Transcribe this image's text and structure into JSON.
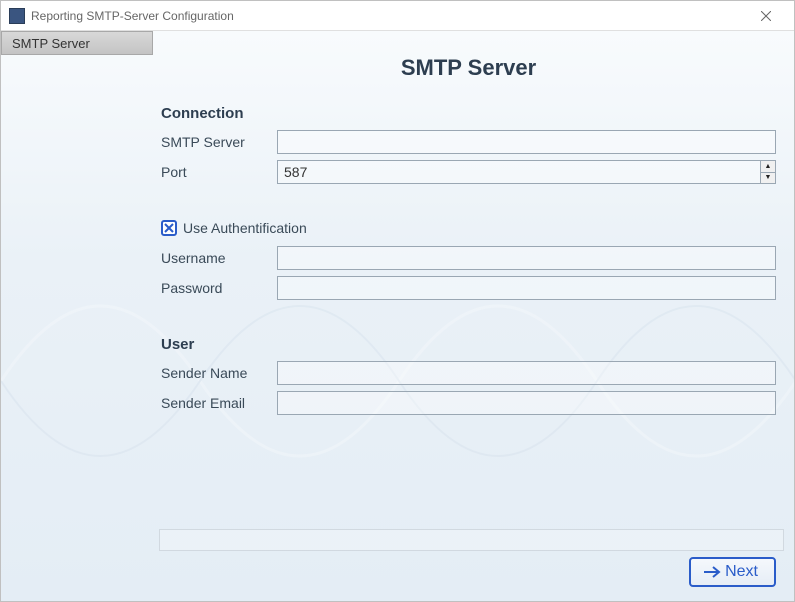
{
  "window": {
    "title": "Reporting SMTP-Server Configuration"
  },
  "sidebar": {
    "items": [
      {
        "label": "SMTP Server"
      }
    ]
  },
  "page": {
    "title": "SMTP Server"
  },
  "sections": {
    "connection": {
      "heading": "Connection",
      "smtp_server_label": "SMTP Server",
      "smtp_server_value": "",
      "port_label": "Port",
      "port_value": "587"
    },
    "auth": {
      "checkbox_label": "Use Authentification",
      "checked": true,
      "username_label": "Username",
      "username_value": "",
      "password_label": "Password",
      "password_value": ""
    },
    "user": {
      "heading": "User",
      "sender_name_label": "Sender Name",
      "sender_name_value": "",
      "sender_email_label": "Sender Email",
      "sender_email_value": ""
    }
  },
  "footer": {
    "next_label": "Next"
  }
}
